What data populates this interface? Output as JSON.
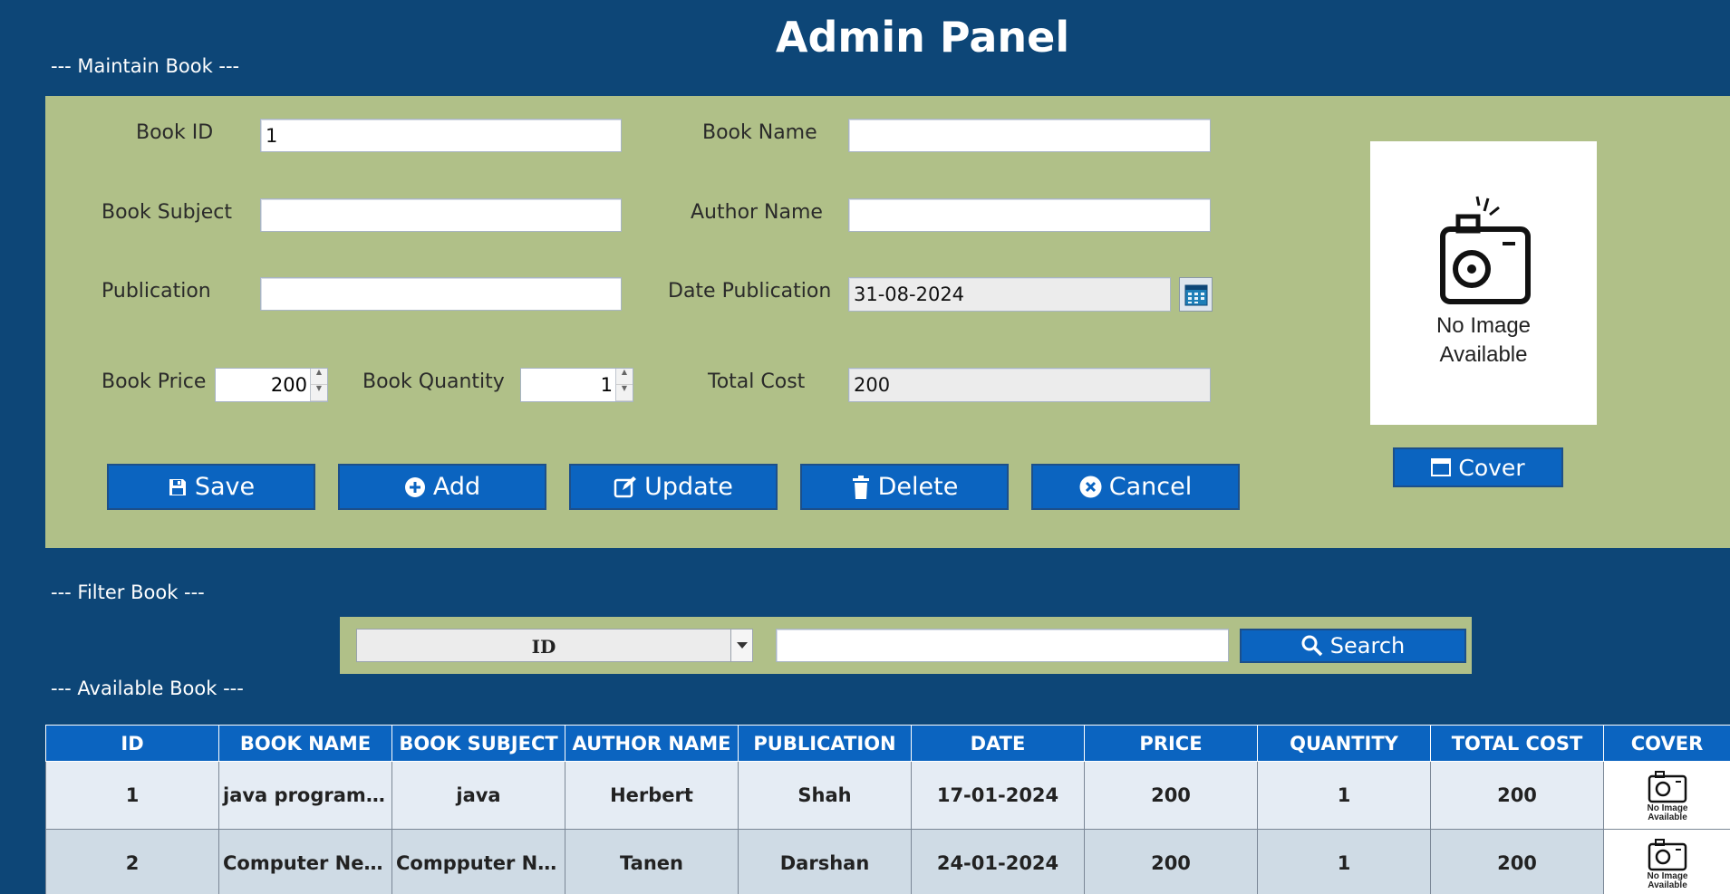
{
  "header": {
    "title": "Admin Panel"
  },
  "sections": {
    "maintain": "--- Maintain Book ---",
    "filter": "--- Filter Book ---",
    "available": "--- Available Book ---"
  },
  "form": {
    "book_id": {
      "label": "Book ID",
      "value": "1"
    },
    "book_name": {
      "label": "Book Name",
      "value": ""
    },
    "book_subject": {
      "label": "Book Subject",
      "value": ""
    },
    "author_name": {
      "label": "Author Name",
      "value": ""
    },
    "publication": {
      "label": "Publication",
      "value": ""
    },
    "date_publication": {
      "label": "Date Publication",
      "value": "31-08-2024"
    },
    "book_price": {
      "label": "Book Price",
      "value": "200"
    },
    "book_quantity": {
      "label": "Book Quantity",
      "value": "1"
    },
    "total_cost": {
      "label": "Total Cost",
      "value": "200"
    }
  },
  "cover_placeholder": {
    "line1": "No Image",
    "line2": "Available"
  },
  "buttons": {
    "save": "Save",
    "add": "Add",
    "update": "Update",
    "delete": "Delete",
    "cancel": "Cancel",
    "cover": "Cover",
    "search": "Search"
  },
  "filter": {
    "selected": "ID",
    "query": ""
  },
  "table": {
    "columns": [
      "ID",
      "BOOK NAME",
      "BOOK SUBJECT",
      "AUTHOR NAME",
      "PUBLICATION",
      "DATE",
      "PRICE",
      "QUANTITY",
      "TOTAL COST",
      "COVER"
    ],
    "rows": [
      [
        "1",
        "java programming",
        "java",
        "Herbert",
        "Shah",
        "17-01-2024",
        "200",
        "1",
        "200"
      ],
      [
        "2",
        "Computer Netwo...",
        "Compputer Netw...",
        "Tanen",
        "Darshan",
        "24-01-2024",
        "200",
        "1",
        "200"
      ]
    ],
    "cover_thumb": {
      "line1": "No Image",
      "line2": "Available"
    }
  },
  "colors": {
    "background": "#0d4677",
    "panel": "#b0c088",
    "button": "#0b64c0",
    "header": "#0b64c0"
  }
}
